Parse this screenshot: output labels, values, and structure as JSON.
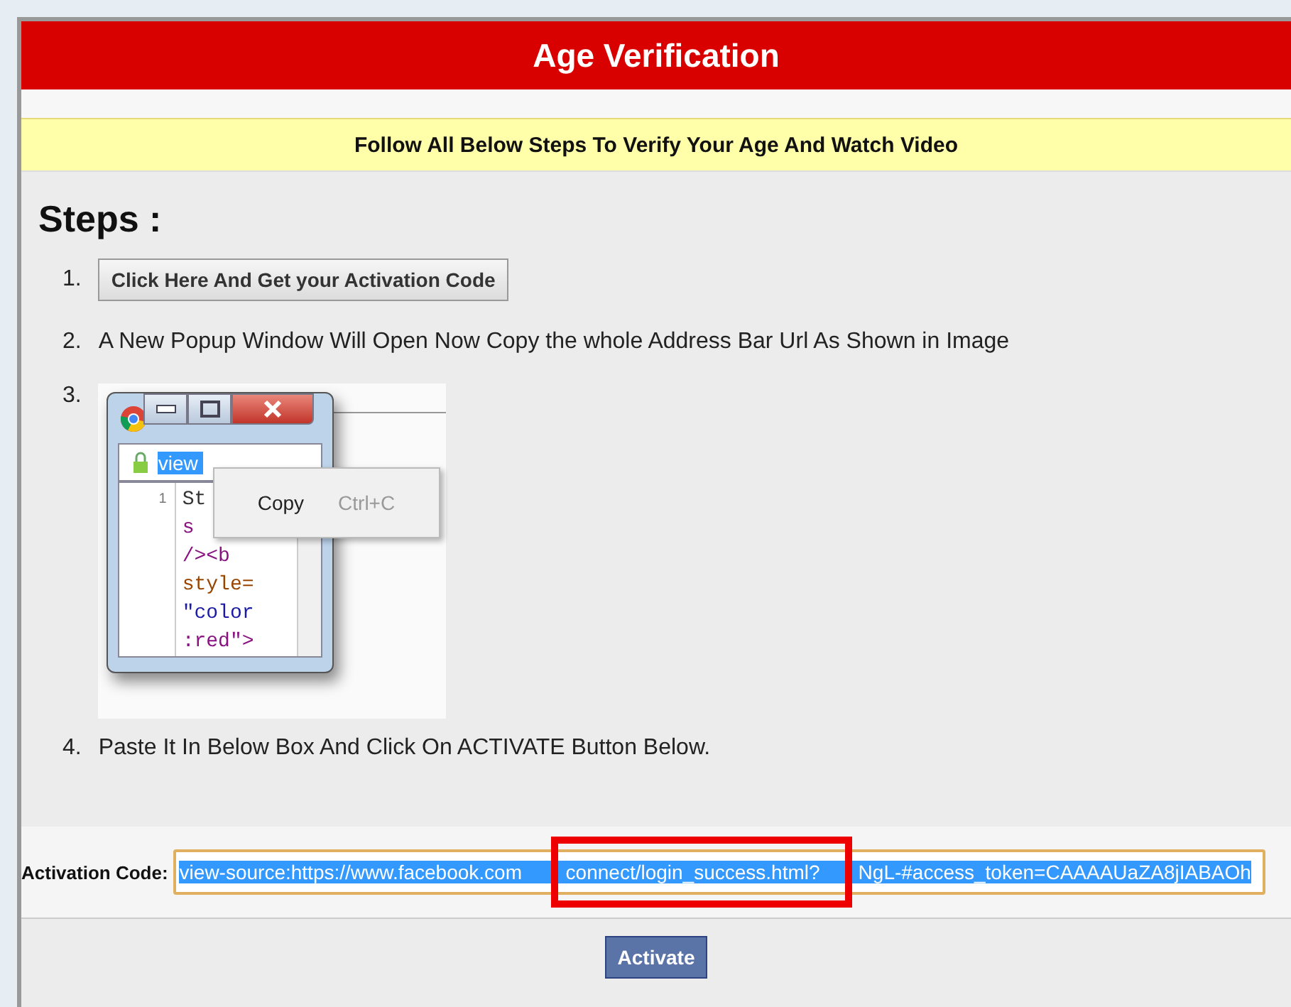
{
  "header": {
    "title": "Age Verification"
  },
  "notice": "Follow All Below Steps To Verify Your Age And Watch Video",
  "steps_heading": "Steps :",
  "steps": [
    {
      "number": "1.",
      "kind": "button",
      "label": "Click Here And Get your Activation Code"
    },
    {
      "number": "2.",
      "kind": "text",
      "text": "A New Popup Window Will Open Now Copy the whole Address Bar Url As Shown in Image"
    },
    {
      "number": "3.",
      "kind": "image"
    },
    {
      "number": "4.",
      "kind": "text",
      "text": "Paste It In Below Box And Click On ACTIVATE  Button Below."
    }
  ],
  "example_image": {
    "address": "view",
    "line_number": "1",
    "code_lines": [
      {
        "text": "St",
        "kind": "text"
      },
      {
        "text": "s",
        "kind": "tag"
      },
      {
        "text": "/><b",
        "kind": "tag"
      },
      {
        "text": "style=",
        "kind": "attr"
      },
      {
        "text": "\"color",
        "kind": "value"
      },
      {
        "text": ":red\">",
        "kind": "tag"
      }
    ],
    "menu": {
      "item": "Copy",
      "shortcut": "Ctrl+C"
    }
  },
  "activation": {
    "label": "Activation Code:",
    "value_parts": [
      "view-source:https://www.facebook.com",
      "connect/login_success.html?",
      "NgL-#access_token=CAAAAUaZA8jIABAOh"
    ],
    "highlighted": true
  },
  "activate_button": "Activate"
}
